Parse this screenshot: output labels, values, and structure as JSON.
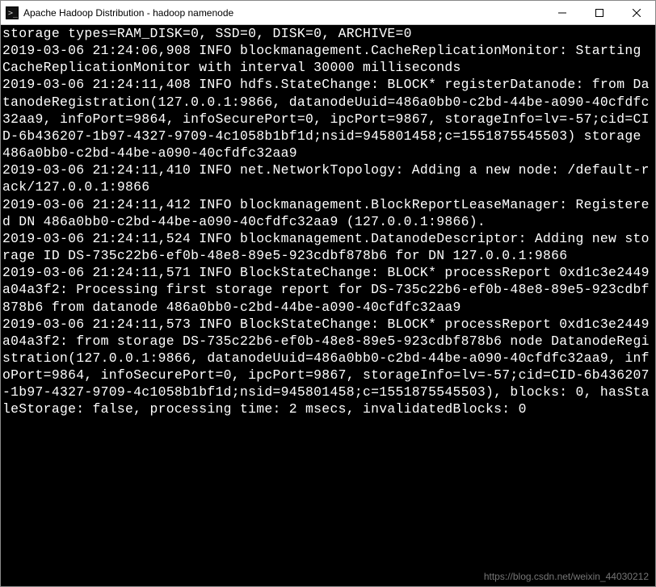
{
  "titlebar": {
    "icon": "terminal-icon",
    "title": "Apache Hadoop Distribution - hadoop   namenode",
    "minimize": "–",
    "maximize": "□",
    "close": "×"
  },
  "console_lines": [
    "storage types=RAM_DISK=0, SSD=0, DISK=0, ARCHIVE=0",
    "2019-03-06 21:24:06,908 INFO blockmanagement.CacheReplicationMonitor: Starting CacheReplicationMonitor with interval 30000 milliseconds",
    "2019-03-06 21:24:11,408 INFO hdfs.StateChange: BLOCK* registerDatanode: from DatanodeRegistration(127.0.0.1:9866, datanodeUuid=486a0bb0-c2bd-44be-a090-40cfdfc32aa9, infoPort=9864, infoSecurePort=0, ipcPort=9867, storageInfo=lv=-57;cid=CID-6b436207-1b97-4327-9709-4c1058b1bf1d;nsid=945801458;c=1551875545503) storage 486a0bb0-c2bd-44be-a090-40cfdfc32aa9",
    "2019-03-06 21:24:11,410 INFO net.NetworkTopology: Adding a new node: /default-rack/127.0.0.1:9866",
    "2019-03-06 21:24:11,412 INFO blockmanagement.BlockReportLeaseManager: Registered DN 486a0bb0-c2bd-44be-a090-40cfdfc32aa9 (127.0.0.1:9866).",
    "2019-03-06 21:24:11,524 INFO blockmanagement.DatanodeDescriptor: Adding new storage ID DS-735c22b6-ef0b-48e8-89e5-923cdbf878b6 for DN 127.0.0.1:9866",
    "2019-03-06 21:24:11,571 INFO BlockStateChange: BLOCK* processReport 0xd1c3e2449a04a3f2: Processing first storage report for DS-735c22b6-ef0b-48e8-89e5-923cdbf878b6 from datanode 486a0bb0-c2bd-44be-a090-40cfdfc32aa9",
    "2019-03-06 21:24:11,573 INFO BlockStateChange: BLOCK* processReport 0xd1c3e2449a04a3f2: from storage DS-735c22b6-ef0b-48e8-89e5-923cdbf878b6 node DatanodeRegistration(127.0.0.1:9866, datanodeUuid=486a0bb0-c2bd-44be-a090-40cfdfc32aa9, infoPort=9864, infoSecurePort=0, ipcPort=9867, storageInfo=lv=-57;cid=CID-6b436207-1b97-4327-9709-4c1058b1bf1d;nsid=945801458;c=1551875545503), blocks: 0, hasStaleStorage: false, processing time: 2 msecs, invalidatedBlocks: 0"
  ],
  "watermark": "https://blog.csdn.net/weixin_44030212"
}
